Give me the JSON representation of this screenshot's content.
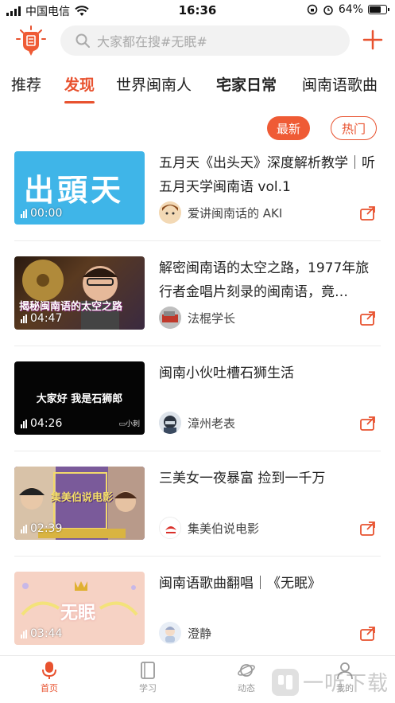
{
  "status_bar": {
    "carrier": "中国电信",
    "time": "16:36",
    "battery": "64%"
  },
  "header": {
    "search_placeholder": "大家都在搜#无眠#"
  },
  "tabs": [
    {
      "label": "推荐"
    },
    {
      "label": "发现"
    },
    {
      "label": "世界闽南人"
    },
    {
      "label": "宅家日常"
    },
    {
      "label": "闽南语歌曲"
    }
  ],
  "filters": {
    "newest": "最新",
    "hot": "热门"
  },
  "items": [
    {
      "title": "五月天《出头天》深度解析教学｜听五月天学闽南语 vol.1",
      "author": "爱讲闽南话的 AKI",
      "duration": "00:00",
      "thumb_text": "出頭天"
    },
    {
      "title": "解密闽南语的太空之路，1977年旅行者金唱片刻录的闽南语，竟…",
      "author": "法棍学长",
      "duration": "04:47",
      "thumb_text": "揭秘闽南语的太空之路"
    },
    {
      "title": "闽南小伙吐槽石狮生活",
      "author": "漳州老表",
      "duration": "04:26",
      "thumb_text": "大家好 我是石狮郎"
    },
    {
      "title": "三美女一夜暴富 捡到一千万",
      "author": "集美伯说电影",
      "duration": "02:39",
      "thumb_text": "集美伯说电影"
    },
    {
      "title": "闽南语歌曲翻唱｜《无眠》",
      "author": "澄静",
      "duration": "03:44",
      "thumb_text": "无眠"
    }
  ],
  "bottom_nav": [
    {
      "label": "首页"
    },
    {
      "label": "学习"
    },
    {
      "label": "动态"
    },
    {
      "label": "我的"
    }
  ],
  "watermark": "一听下载",
  "colors": {
    "accent": "#e8522f",
    "tab_active": "#e8522f"
  }
}
